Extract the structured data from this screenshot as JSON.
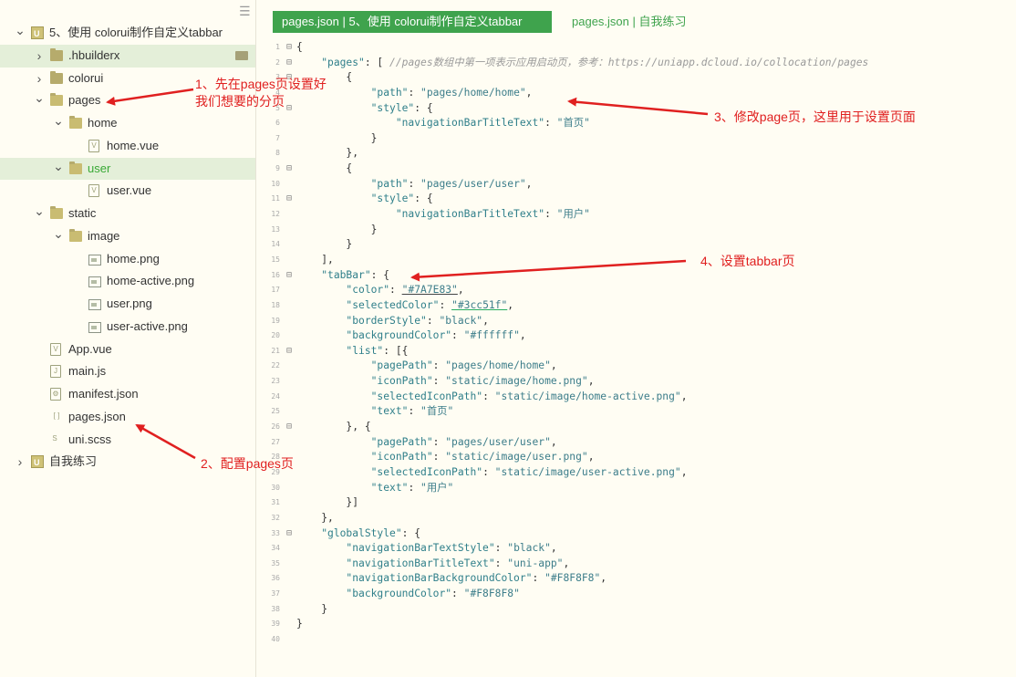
{
  "menu_icon": "hamburger-icon",
  "tree": [
    {
      "depth": 0,
      "chev": "v",
      "icon": "project",
      "label": "5、使用 colorui制作自定义tabbar",
      "badge": false,
      "sel": false
    },
    {
      "depth": 1,
      "chev": ">",
      "icon": "folder",
      "label": ".hbuilderx",
      "badge": true,
      "sel": true
    },
    {
      "depth": 1,
      "chev": ">",
      "icon": "folder",
      "label": "colorui",
      "badge": false,
      "sel": false
    },
    {
      "depth": 1,
      "chev": "v",
      "icon": "folder-open",
      "label": "pages",
      "badge": false,
      "sel": false
    },
    {
      "depth": 2,
      "chev": "v",
      "icon": "folder-open",
      "label": "home",
      "badge": false,
      "sel": false
    },
    {
      "depth": 3,
      "chev": "",
      "icon": "vue",
      "label": "home.vue",
      "badge": false,
      "sel": false
    },
    {
      "depth": 2,
      "chev": "v",
      "icon": "folder-open",
      "label": "user",
      "badge": false,
      "sel": true,
      "green": true
    },
    {
      "depth": 3,
      "chev": "",
      "icon": "vue",
      "label": "user.vue",
      "badge": false,
      "sel": false
    },
    {
      "depth": 1,
      "chev": "v",
      "icon": "folder-open",
      "label": "static",
      "badge": false,
      "sel": false
    },
    {
      "depth": 2,
      "chev": "v",
      "icon": "folder-open",
      "label": "image",
      "badge": false,
      "sel": false
    },
    {
      "depth": 3,
      "chev": "",
      "icon": "image",
      "label": "home.png",
      "badge": false,
      "sel": false
    },
    {
      "depth": 3,
      "chev": "",
      "icon": "image",
      "label": "home-active.png",
      "badge": false,
      "sel": false
    },
    {
      "depth": 3,
      "chev": "",
      "icon": "image",
      "label": "user.png",
      "badge": false,
      "sel": false
    },
    {
      "depth": 3,
      "chev": "",
      "icon": "image",
      "label": "user-active.png",
      "badge": false,
      "sel": false
    },
    {
      "depth": 1,
      "chev": "",
      "icon": "vue",
      "label": "App.vue",
      "badge": false,
      "sel": false
    },
    {
      "depth": 1,
      "chev": "",
      "icon": "js",
      "label": "main.js",
      "badge": false,
      "sel": false
    },
    {
      "depth": 1,
      "chev": "",
      "icon": "json-gear",
      "label": "manifest.json",
      "badge": false,
      "sel": false
    },
    {
      "depth": 1,
      "chev": "",
      "icon": "json",
      "label": "pages.json",
      "badge": false,
      "sel": false
    },
    {
      "depth": 1,
      "chev": "",
      "icon": "scss",
      "label": "uni.scss",
      "badge": false,
      "sel": false
    },
    {
      "depth": 0,
      "chev": ">",
      "icon": "project",
      "label": "自我练习",
      "badge": false,
      "sel": false
    }
  ],
  "tabs": {
    "active": "pages.json | 5、使用 colorui制作自定义tabbar",
    "second": "pages.json | 自我练习"
  },
  "code_lines": [
    {
      "n": "1",
      "f": "⊟",
      "t": "{"
    },
    {
      "n": "2",
      "f": "⊟",
      "t": "    \"pages\": [ //pages数组中第一项表示应用启动页，参考：https://uniapp.dcloud.io/collocation/pages"
    },
    {
      "n": "3",
      "f": "⊟",
      "t": "        {"
    },
    {
      "n": "4",
      "f": "",
      "t": "            \"path\": \"pages/home/home\","
    },
    {
      "n": "5",
      "f": "⊟",
      "t": "            \"style\": {"
    },
    {
      "n": "6",
      "f": "",
      "t": "                \"navigationBarTitleText\": \"首页\""
    },
    {
      "n": "7",
      "f": "",
      "t": "            }"
    },
    {
      "n": "8",
      "f": "",
      "t": "        },"
    },
    {
      "n": "9",
      "f": "⊟",
      "t": "        {"
    },
    {
      "n": "10",
      "f": "",
      "t": "            \"path\": \"pages/user/user\","
    },
    {
      "n": "11",
      "f": "⊟",
      "t": "            \"style\": {"
    },
    {
      "n": "12",
      "f": "",
      "t": "                \"navigationBarTitleText\": \"用户\""
    },
    {
      "n": "13",
      "f": "",
      "t": "            }"
    },
    {
      "n": "14",
      "f": "",
      "t": "        }"
    },
    {
      "n": "15",
      "f": "",
      "t": "    ],"
    },
    {
      "n": "16",
      "f": "⊟",
      "t": "    \"tabBar\": {"
    },
    {
      "n": "17",
      "f": "",
      "t": "        \"color\": \"#7A7E83\","
    },
    {
      "n": "18",
      "f": "",
      "t": "        \"selectedColor\": \"#3cc51f\","
    },
    {
      "n": "19",
      "f": "",
      "t": "        \"borderStyle\": \"black\","
    },
    {
      "n": "20",
      "f": "",
      "t": "        \"backgroundColor\": \"#ffffff\","
    },
    {
      "n": "21",
      "f": "⊟",
      "t": "        \"list\": [{"
    },
    {
      "n": "22",
      "f": "",
      "t": "            \"pagePath\": \"pages/home/home\","
    },
    {
      "n": "23",
      "f": "",
      "t": "            \"iconPath\": \"static/image/home.png\","
    },
    {
      "n": "24",
      "f": "",
      "t": "            \"selectedIconPath\": \"static/image/home-active.png\","
    },
    {
      "n": "25",
      "f": "",
      "t": "            \"text\": \"首页\""
    },
    {
      "n": "26",
      "f": "⊟",
      "t": "        }, {"
    },
    {
      "n": "27",
      "f": "",
      "t": "            \"pagePath\": \"pages/user/user\","
    },
    {
      "n": "28",
      "f": "",
      "t": "            \"iconPath\": \"static/image/user.png\","
    },
    {
      "n": "29",
      "f": "",
      "t": "            \"selectedIconPath\": \"static/image/user-active.png\","
    },
    {
      "n": "30",
      "f": "",
      "t": "            \"text\": \"用户\""
    },
    {
      "n": "31",
      "f": "",
      "t": "        }]"
    },
    {
      "n": "32",
      "f": "",
      "t": "    },"
    },
    {
      "n": "33",
      "f": "⊟",
      "t": "    \"globalStyle\": {"
    },
    {
      "n": "34",
      "f": "",
      "t": "        \"navigationBarTextStyle\": \"black\","
    },
    {
      "n": "35",
      "f": "",
      "t": "        \"navigationBarTitleText\": \"uni-app\","
    },
    {
      "n": "36",
      "f": "",
      "t": "        \"navigationBarBackgroundColor\": \"#F8F8F8\","
    },
    {
      "n": "37",
      "f": "",
      "t": "        \"backgroundColor\": \"#F8F8F8\""
    },
    {
      "n": "38",
      "f": "",
      "t": "    }"
    },
    {
      "n": "39",
      "f": "",
      "t": "}"
    },
    {
      "n": "40",
      "f": "",
      "t": ""
    }
  ],
  "annotations": {
    "a1_line1": "1、先在pages页设置好",
    "a1_line2": "我们想要的分页",
    "a2": "2、配置pages页",
    "a3": "3、修改page页，这里用于设置页面",
    "a4": "4、设置tabbar页"
  },
  "colors": {
    "accent": "#3fa34d",
    "annotation": "#e02020",
    "background": "#fffdf3"
  }
}
